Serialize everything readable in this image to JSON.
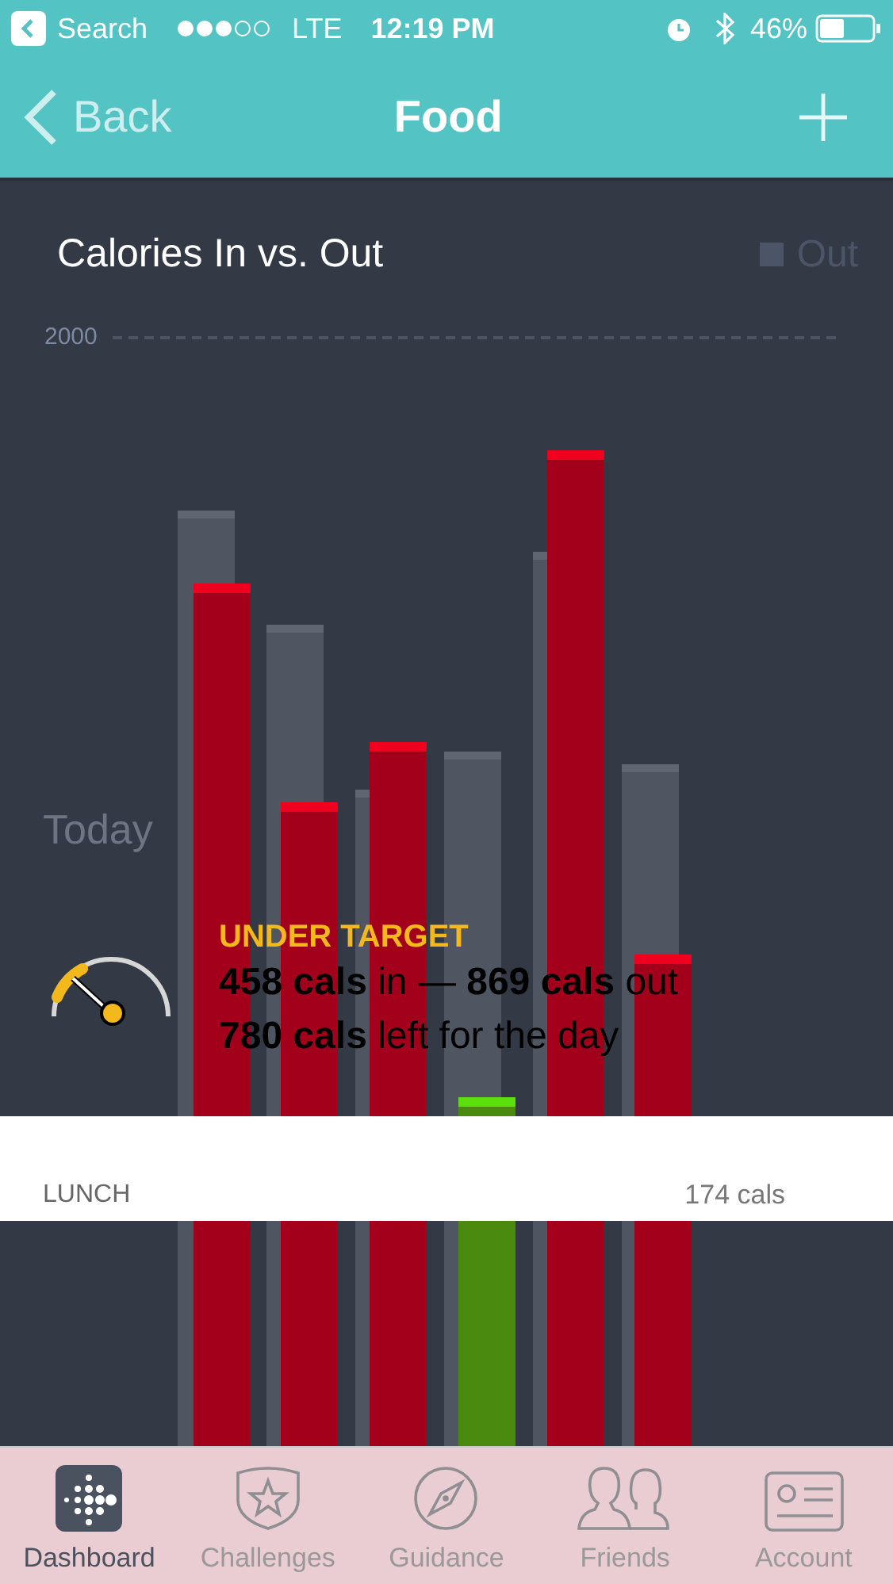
{
  "status_bar": {
    "back_app": "Search",
    "network": "LTE",
    "time": "12:19 PM",
    "battery": "46%"
  },
  "nav": {
    "back": "Back",
    "title": "Food"
  },
  "chart": {
    "title": "Calories In vs. Out",
    "legend": "Out",
    "tick": "2000",
    "day_label": "Today"
  },
  "summary": {
    "status": "UNDER TARGET",
    "line_1": "**458 cals** in — **869 cals** out",
    "line_2": "**780 cals** left for the day"
  },
  "meal": {
    "name": "LUNCH",
    "calories": "174 cals"
  },
  "tabs": [
    {
      "label": "Dashboard",
      "kind": "dashboard",
      "selected": true
    },
    {
      "label": "Challenges",
      "kind": "challenges",
      "selected": false
    },
    {
      "label": "Guidance",
      "kind": "guidance",
      "selected": false
    },
    {
      "label": "Friends",
      "kind": "friends",
      "selected": false
    },
    {
      "label": "Account",
      "kind": "account",
      "selected": false
    }
  ]
}
